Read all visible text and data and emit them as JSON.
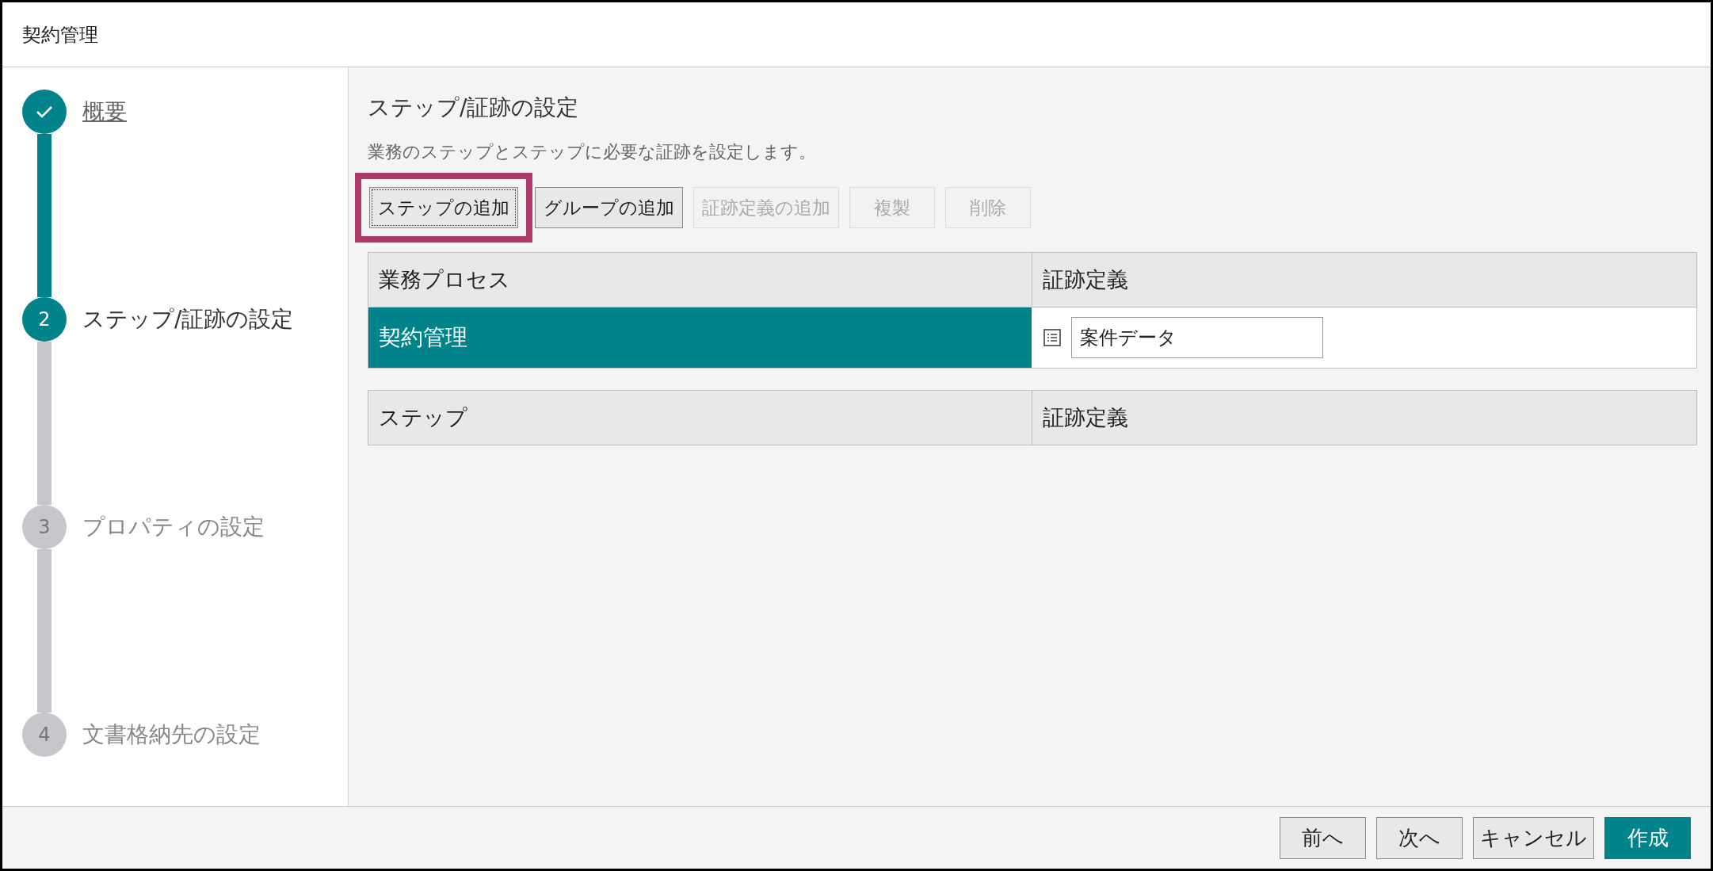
{
  "window": {
    "title": "契約管理"
  },
  "steps": [
    {
      "completed": true,
      "selected": false,
      "label": "概要"
    },
    {
      "number": "2",
      "completed": false,
      "selected": true,
      "label": "ステップ/証跡の設定"
    },
    {
      "number": "3",
      "completed": false,
      "selected": false,
      "label": "プロパティの設定"
    },
    {
      "number": "4",
      "completed": false,
      "selected": false,
      "label": "文書格納先の設定"
    }
  ],
  "main": {
    "title": "ステップ/証跡の設定",
    "description": "業務のステップとステップに必要な証跡を設定します。",
    "toolbar": [
      {
        "label": "ステップの追加",
        "disabled": false,
        "highlighted": true
      },
      {
        "label": "グループの追加",
        "disabled": false,
        "highlighted": false
      },
      {
        "label": "証跡定義の追加",
        "disabled": true,
        "highlighted": false
      },
      {
        "label": "複製",
        "disabled": true,
        "highlighted": false
      },
      {
        "label": "削除",
        "disabled": true,
        "highlighted": false
      }
    ],
    "process_table": {
      "columns": [
        "業務プロセス",
        "証跡定義"
      ],
      "rows": [
        {
          "name": "契約管理",
          "selected": true,
          "evidence": "案件データ"
        }
      ]
    },
    "step_table": {
      "columns": [
        "ステップ",
        "証跡定義"
      ]
    }
  },
  "footer": {
    "buttons": [
      {
        "label": "前へ",
        "primary": false
      },
      {
        "label": "次へ",
        "primary": false
      },
      {
        "label": "キャンセル",
        "primary": false
      },
      {
        "label": "作成",
        "primary": true
      }
    ]
  }
}
